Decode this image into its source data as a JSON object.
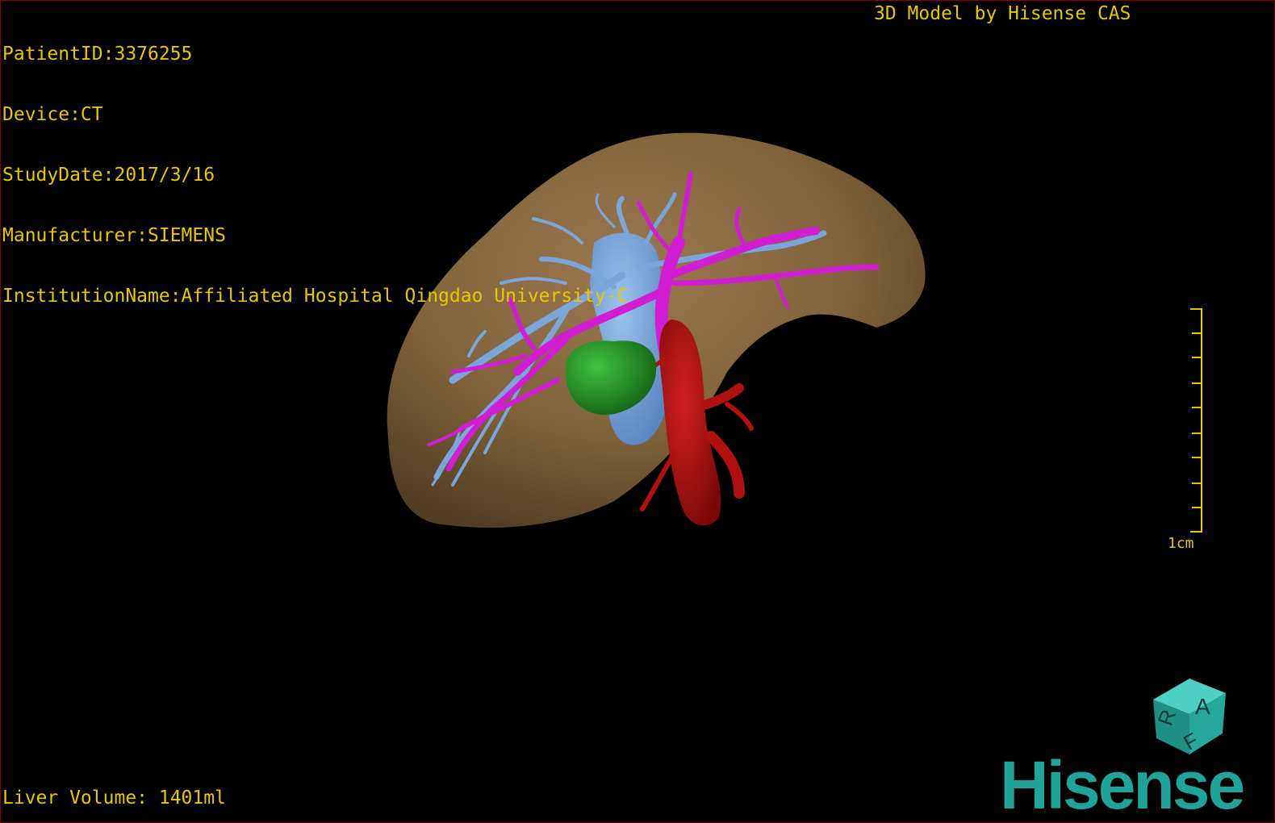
{
  "overlay": {
    "patient_id": "PatientID:3376255",
    "device": "Device:CT",
    "study_date": "StudyDate:2017/3/16",
    "manufacturer": "Manufacturer:SIEMENS",
    "institution": "InstitutionName:Affiliated Hospital Qingdao University-C",
    "model_credit": "3D Model by Hisense CAS",
    "liver_volume": "Liver Volume: 1401ml"
  },
  "scale_bar": {
    "label": "1cm"
  },
  "orientation_cube": {
    "faces": [
      "A",
      "R",
      "F"
    ]
  },
  "brand": {
    "logo_text": "Hisense"
  },
  "colors": {
    "overlay_text": "#e8c700",
    "liver": "#8a6a40",
    "portal_vein": "#d21ed2",
    "hepatic_vein": "#6f9fd8",
    "artery": "#b01010",
    "tumor": "#1f8f1f",
    "brand": "#1fa39a"
  },
  "structures": [
    "liver",
    "hepatic-vein",
    "portal-vein",
    "artery",
    "tumor"
  ]
}
